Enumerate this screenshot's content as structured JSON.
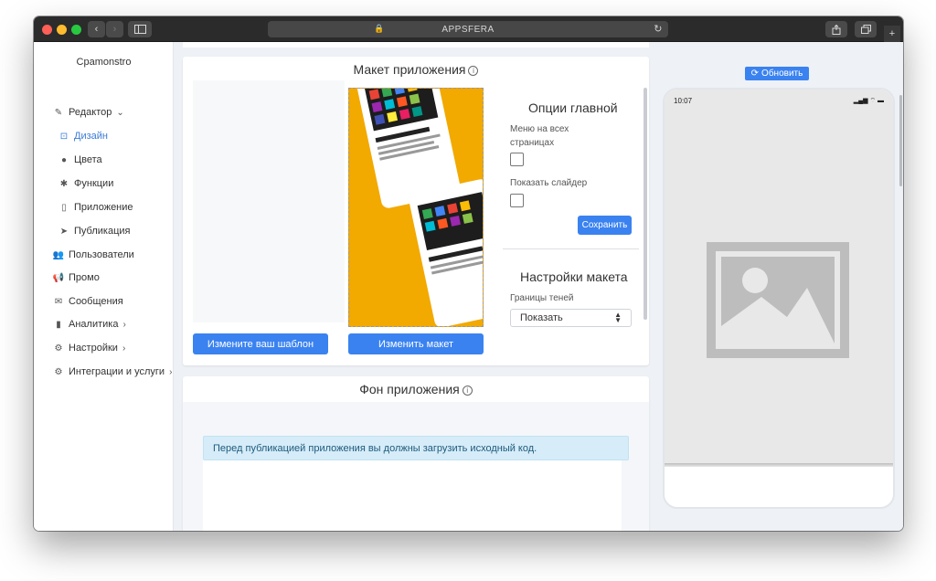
{
  "browser": {
    "url_text": "APPSFERA",
    "nav_back": "‹",
    "nav_forward": "›"
  },
  "sidebar": {
    "brand": "Cpamonstro",
    "items": [
      {
        "label": "Редактор",
        "icon": "pencil-icon",
        "chevron": "⌄"
      },
      {
        "label": "Дизайн",
        "icon": "design-icon"
      },
      {
        "label": "Цвета",
        "icon": "palette-icon"
      },
      {
        "label": "Функции",
        "icon": "puzzle-icon"
      },
      {
        "label": "Приложение",
        "icon": "mobile-icon"
      },
      {
        "label": "Публикация",
        "icon": "paper-plane-icon"
      },
      {
        "label": "Пользователи",
        "icon": "users-icon"
      },
      {
        "label": "Промо",
        "icon": "megaphone-icon"
      },
      {
        "label": "Сообщения",
        "icon": "envelope-icon"
      },
      {
        "label": "Аналитика",
        "icon": "bar-chart-icon",
        "chevron": "›"
      },
      {
        "label": "Настройки",
        "icon": "settings-icon",
        "chevron": "›"
      },
      {
        "label": "Интеграции и услуги",
        "icon": "cogs-icon",
        "chevron": "›"
      }
    ]
  },
  "layout_card": {
    "title": "Макет приложения",
    "info": "i",
    "change_template_button": "Измените ваш шаблон",
    "change_layout_button": "Изменить макет"
  },
  "main_options": {
    "title": "Опции главной",
    "menu_all_pages_label": "Меню на всех страницах",
    "show_slider_label": "Показать слайдер",
    "save_button": "Сохранить"
  },
  "layout_settings": {
    "title": "Настройки макета",
    "shadow_borders_label": "Границы теней",
    "shadow_borders_value": "Показать"
  },
  "background_card": {
    "title": "Фон приложения",
    "info": "i",
    "alert": "Перед публикацией приложения вы должны загрузить исходный код."
  },
  "preview": {
    "refresh_button": "Обновить",
    "time": "10:07",
    "status_icons": "▂▄▆ ⌔ ▬"
  },
  "colors": {
    "accent": "#3a82f0",
    "sidebar_active": "#3a7bd5",
    "alert_bg": "#d6ecf8",
    "template_yellow": "#f3b300"
  }
}
